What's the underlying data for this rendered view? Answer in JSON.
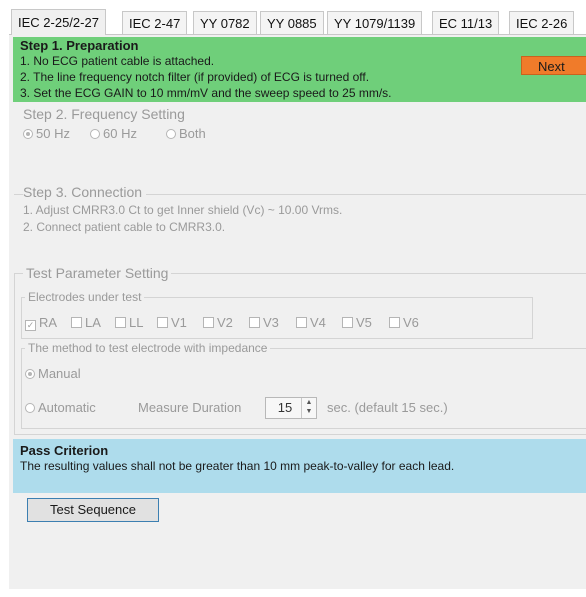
{
  "tabs": [
    "IEC 2-25/2-27",
    "IEC 2-47",
    "YY 0782",
    "YY 0885",
    "YY 1079/1139",
    "EC 11/13",
    "IEC 2-26"
  ],
  "step1": {
    "title": "Step 1. Preparation",
    "lines": [
      "1. No ECG patient cable is attached.",
      "2. The line frequency notch filter (if provided) of ECG is turned off.",
      "3. Set the ECG GAIN to 10 mm/mV and the sweep speed to 25 mm/s."
    ],
    "next_label": "Next"
  },
  "step2": {
    "title": "Step 2. Frequency Setting",
    "options": [
      "50 Hz",
      "60 Hz",
      "Both"
    ],
    "selected": "50 Hz"
  },
  "step3": {
    "title": "Step 3. Connection",
    "lines": [
      "1. Adjust CMRR3.0 Ct to get Inner shield (Vc) ~ 10.00 Vrms.",
      "2. Connect patient cable to CMRR3.0."
    ]
  },
  "params": {
    "title": "Test Parameter Setting",
    "electrodes_title": "Electrodes under test",
    "electrodes": [
      "RA",
      "LA",
      "LL",
      "V1",
      "V2",
      "V3",
      "V4",
      "V5",
      "V6"
    ],
    "checked": [
      "RA"
    ],
    "method_title": "The method to test electrode with impedance",
    "manual": "Manual",
    "automatic": "Automatic",
    "measure_duration_label": "Measure Duration",
    "duration_value": "15",
    "duration_hint": "sec. (default 15 sec.)"
  },
  "pass": {
    "title": "Pass Criterion",
    "text": "The resulting values shall not be greater than 10 mm peak-to-valley for each lead."
  },
  "test_sequence_label": "Test Sequence"
}
